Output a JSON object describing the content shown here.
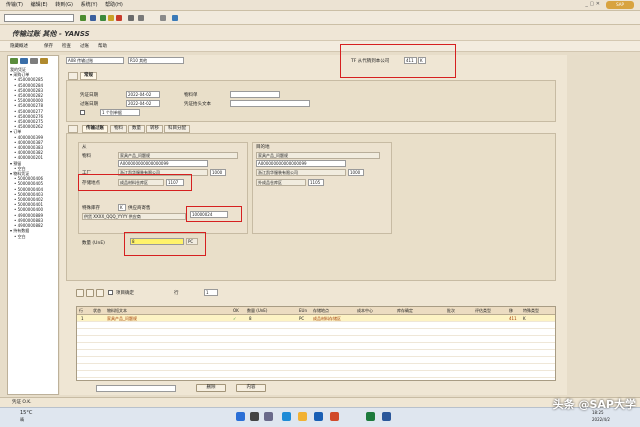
{
  "menubar": {
    "items": [
      "传输(T)",
      "编辑(E)",
      "转到(G)",
      "系统(Y)",
      "帮助(H)"
    ],
    "sap_label": "SAP"
  },
  "window": {
    "title": "传输过账 其他 - YANSS"
  },
  "app_toolbar": {
    "items": [
      "隐藏概述",
      "保存",
      "检查",
      "过账",
      "帮助"
    ]
  },
  "tree": {
    "nodes": [
      "我的凭证",
      "▾ 采购订单",
      "• 4500000285",
      "• 4500000284",
      "• 4500000283",
      "• 4500000282",
      "• 5500000000",
      "• 4500000278",
      "• 4500000277",
      "• 4500000276",
      "• 4500000275",
      "• 4500000262",
      "▾ 订单",
      "• 4000000399",
      "• 4000000387",
      "• 4000000383",
      "• 4000000382",
      "• 4000000201",
      "▾ 预留",
      "• 空白",
      "▾ 物料凭证",
      "• 5000000406",
      "• 5000000405",
      "• 5000000404",
      "• 5000000403",
      "• 5000000402",
      "• 5000000401",
      "• 5000000400",
      "• 4900000889",
      "• 4900000883",
      "• 4900000882",
      "▾ 持有数据",
      "• 空白"
    ]
  },
  "header": {
    "transaction_select": "A08 传输过账",
    "ref_select": "R10 其他",
    "movement_label": "TF 从代销到本公司",
    "movement_type": "411",
    "special_stock": "K",
    "tab_general": "常规",
    "doc_date_label": "凭证日期",
    "doc_date": "2022-04-02",
    "post_date_label": "过账日期",
    "post_date": "2022-04-02",
    "slip_label": "物料单",
    "header_text_label": "凭证抬头文本",
    "print_option": "1 个别单据"
  },
  "item_tabs": [
    "传输过账",
    "物料",
    "数量",
    "转移",
    "科目分配"
  ],
  "from": {
    "section": "从",
    "material_label": "物料",
    "material_name": "家具产品_问题规",
    "material_no": "A000000000000000099",
    "plant_label": "工厂",
    "plant_name": "浙江凯华服装有限公司",
    "plant": "1000",
    "sloc_label": "存储地点",
    "sloc_name": "成品材料仓库区",
    "sloc": "1107",
    "special_stock_label": "特殊库存",
    "special_stock_ind": "K",
    "special_stock_desc": "供应商寄售",
    "vendor_desc": "供货 XXXX_QQQ_YYYY 供应商",
    "vendor": "10000024"
  },
  "to": {
    "section": "目的地",
    "material_name": "家具产品_问题规",
    "material_no": "A000000000000000099",
    "plant_name": "浙江凯华服装有限公司",
    "plant": "1000",
    "sloc_name": "外成品仓库区",
    "sloc": "1105"
  },
  "qty": {
    "label": "数量 (UnE)",
    "value": "8",
    "unit": "PC"
  },
  "item_bar": {
    "ok_label": "项目确定",
    "line_label": "行",
    "line_no": "1"
  },
  "grid": {
    "headers": [
      "行",
      "状态",
      "物料短文本",
      "OK",
      "数量 (UnE)",
      "EUn",
      "存储地点",
      "成本中心",
      "库存确定",
      "批次",
      "评估类型",
      "移",
      "特殊类型"
    ],
    "rows": [
      {
        "line": "1",
        "text": "家具产品_问题规",
        "ok": "✓",
        "qty": "8",
        "eun": "PC",
        "sloc": "成品材料存储区",
        "mvt": "411",
        "sp": "K"
      }
    ]
  },
  "bottom_buttons": {
    "delete": "删除",
    "contents": "内容"
  },
  "status": {
    "text": "凭证 O.K."
  },
  "taskbar": {
    "weather": "15°C",
    "weather_sub": "晴",
    "time": "18:25",
    "date": "2022/4/2"
  },
  "watermark": "头条 @SAP大学",
  "colors": {
    "highlight_red": "#d62020",
    "field_yellow": "#fff36a"
  }
}
